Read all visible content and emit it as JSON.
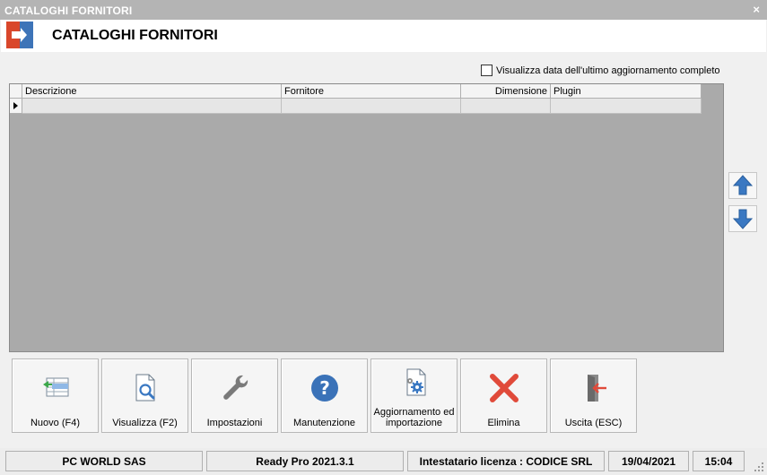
{
  "window": {
    "title": "CATALOGHI FORNITORI",
    "close_glyph": "×"
  },
  "header": {
    "title": "CATALOGHI FORNITORI",
    "logo_icon": "exit-door-icon",
    "logo_colors": {
      "left": "#d9472b",
      "right": "#3d74b8"
    }
  },
  "options": {
    "show_full_update_date_label": "Visualizza data dell'ultimo aggiornamento completo",
    "show_full_update_date_checked": false
  },
  "grid": {
    "columns": [
      {
        "label": "Descrizione"
      },
      {
        "label": "Fornitore"
      },
      {
        "label": "Dimensione"
      },
      {
        "label": "Plugin"
      }
    ],
    "rows": [
      {
        "descrizione": "",
        "fornitore": "",
        "dimensione": "",
        "plugin": ""
      }
    ]
  },
  "side": {
    "move_up_icon": "arrow-up-icon",
    "move_down_icon": "arrow-down-icon",
    "arrow_color": "#3a78c2"
  },
  "toolbar": {
    "nuovo": "Nuovo (F4)",
    "visualizza": "Visualizza (F2)",
    "impostazioni": "Impostazioni",
    "manutenzione": "Manutenzione",
    "aggiornamento": "Aggiornamento ed importazione",
    "elimina": "Elimina",
    "uscita": "Uscita (ESC)"
  },
  "statusbar": {
    "company": "PC WORLD SAS",
    "version": "Ready Pro 2021.3.1",
    "license": "Intestatario licenza : CODICE SRL",
    "date": "19/04/2021",
    "time": "15:04"
  }
}
